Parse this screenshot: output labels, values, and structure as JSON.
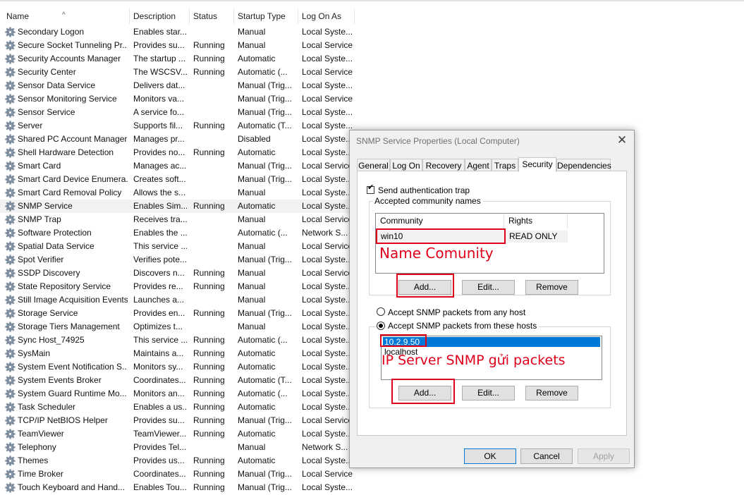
{
  "services": {
    "columns": [
      "Name",
      "Description",
      "Status",
      "Startup Type",
      "Log On As"
    ],
    "rows": [
      [
        "Secondary Logon",
        "Enables star...",
        "",
        "Manual",
        "Local Syste..."
      ],
      [
        "Secure Socket Tunneling Pr...",
        "Provides su...",
        "Running",
        "Manual",
        "Local Service"
      ],
      [
        "Security Accounts Manager",
        "The startup ...",
        "Running",
        "Automatic",
        "Local Syste..."
      ],
      [
        "Security Center",
        "The WSCSV...",
        "Running",
        "Automatic (...",
        "Local Service"
      ],
      [
        "Sensor Data Service",
        "Delivers dat...",
        "",
        "Manual (Trig...",
        "Local Syste..."
      ],
      [
        "Sensor Monitoring Service",
        "Monitors va...",
        "",
        "Manual (Trig...",
        "Local Service"
      ],
      [
        "Sensor Service",
        "A service fo...",
        "",
        "Manual (Trig...",
        "Local Syste..."
      ],
      [
        "Server",
        "Supports fil...",
        "Running",
        "Automatic (T...",
        "Local Syste..."
      ],
      [
        "Shared PC Account Manager",
        "Manages pr...",
        "",
        "Disabled",
        "Local Syste..."
      ],
      [
        "Shell Hardware Detection",
        "Provides no...",
        "Running",
        "Automatic",
        "Local Syste..."
      ],
      [
        "Smart Card",
        "Manages ac...",
        "",
        "Manual (Trig...",
        "Local Service"
      ],
      [
        "Smart Card Device Enumera...",
        "Creates soft...",
        "",
        "Manual (Trig...",
        "Local Syste..."
      ],
      [
        "Smart Card Removal Policy",
        "Allows the s...",
        "",
        "Manual",
        "Local Syste..."
      ],
      [
        "SNMP Service",
        "Enables Sim...",
        "Running",
        "Automatic",
        "Local Syste..."
      ],
      [
        "SNMP Trap",
        "Receives tra...",
        "",
        "Manual",
        "Local Service"
      ],
      [
        "Software Protection",
        "Enables the ...",
        "",
        "Automatic (...",
        "Network S..."
      ],
      [
        "Spatial Data Service",
        "This service ...",
        "",
        "Manual",
        "Local Service"
      ],
      [
        "Spot Verifier",
        "Verifies pote...",
        "",
        "Manual (Trig...",
        "Local Syste..."
      ],
      [
        "SSDP Discovery",
        "Discovers n...",
        "Running",
        "Manual",
        "Local Service"
      ],
      [
        "State Repository Service",
        "Provides re...",
        "Running",
        "Manual",
        "Local Syste..."
      ],
      [
        "Still Image Acquisition Events",
        "Launches a...",
        "",
        "Manual",
        "Local Syste..."
      ],
      [
        "Storage Service",
        "Provides en...",
        "Running",
        "Manual (Trig...",
        "Local Syste..."
      ],
      [
        "Storage Tiers Management",
        "Optimizes t...",
        "",
        "Manual",
        "Local Syste..."
      ],
      [
        "Sync Host_74925",
        "This service ...",
        "Running",
        "Automatic (...",
        "Local Syste..."
      ],
      [
        "SysMain",
        "Maintains a...",
        "Running",
        "Automatic",
        "Local Syste..."
      ],
      [
        "System Event Notification S...",
        "Monitors sy...",
        "Running",
        "Automatic",
        "Local Syste..."
      ],
      [
        "System Events Broker",
        "Coordinates...",
        "Running",
        "Automatic (T...",
        "Local Syste..."
      ],
      [
        "System Guard Runtime Mo...",
        "Monitors an...",
        "Running",
        "Automatic (...",
        "Local Syste..."
      ],
      [
        "Task Scheduler",
        "Enables a us...",
        "Running",
        "Automatic",
        "Local Syste..."
      ],
      [
        "TCP/IP NetBIOS Helper",
        "Provides su...",
        "Running",
        "Manual (Trig...",
        "Local Service"
      ],
      [
        "TeamViewer",
        "TeamViewer...",
        "Running",
        "Automatic",
        "Local Syste..."
      ],
      [
        "Telephony",
        "Provides Tel...",
        "",
        "Manual",
        "Network S..."
      ],
      [
        "Themes",
        "Provides us...",
        "Running",
        "Automatic",
        "Local Syste..."
      ],
      [
        "Time Broker",
        "Coordinates...",
        "Running",
        "Manual (Trig...",
        "Local Service"
      ],
      [
        "Touch Keyboard and Hand...",
        "Enables Tou...",
        "Running",
        "Manual (Trig...",
        "Local Syste..."
      ]
    ],
    "selected_index": 13
  },
  "dialog": {
    "title": "SNMP Service Properties (Local Computer)",
    "close_glyph": "✕",
    "tabs": [
      "General",
      "Log On",
      "Recovery",
      "Agent",
      "Traps",
      "Security",
      "Dependencies"
    ],
    "active_tab": "Security",
    "send_auth_trap": {
      "label": "Send authentication trap",
      "checked": true
    },
    "community_group": {
      "title": "Accepted community names",
      "headers": [
        "Community",
        "Rights"
      ],
      "rows": [
        {
          "community": "win10",
          "rights": "READ ONLY"
        }
      ],
      "buttons": [
        "Add...",
        "Edit...",
        "Remove"
      ]
    },
    "accept_any": {
      "label": "Accept SNMP packets from any host",
      "selected": false
    },
    "accept_these": {
      "label": "Accept SNMP packets from these hosts",
      "selected": true
    },
    "hosts": [
      "10.2.9.50",
      "localhost"
    ],
    "host_buttons": [
      "Add...",
      "Edit...",
      "Remove"
    ],
    "footer_buttons": {
      "ok": "OK",
      "cancel": "Cancel",
      "apply": "Apply"
    }
  },
  "annotations": {
    "community_note": "Name Comunity",
    "host_note": "IP Server SNMP gửi packets",
    "color": "#e0001b"
  }
}
